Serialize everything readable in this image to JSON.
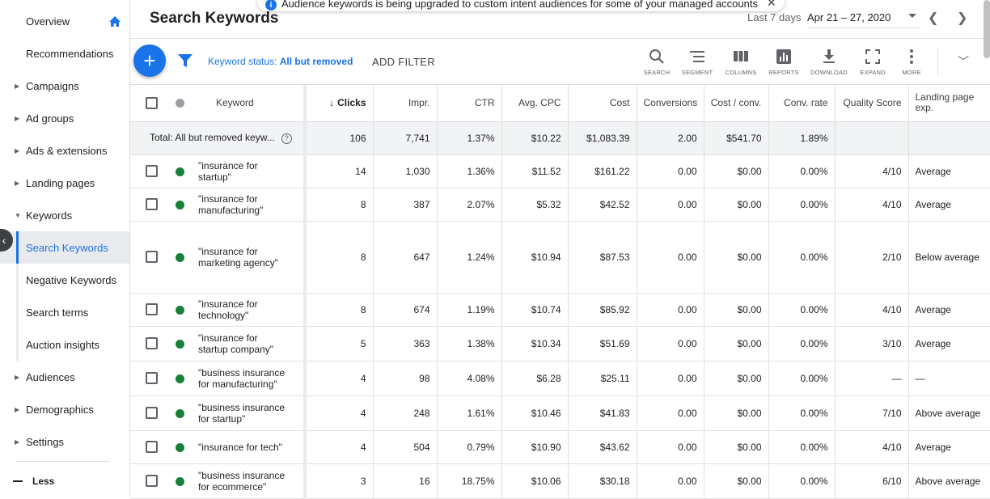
{
  "sidebar": {
    "items": [
      {
        "label": "Overview",
        "caret": false,
        "sub": false
      },
      {
        "label": "Recommendations",
        "caret": false,
        "sub": false
      },
      {
        "label": "Campaigns",
        "caret": true,
        "sub": false
      },
      {
        "label": "Ad groups",
        "caret": true,
        "sub": false
      },
      {
        "label": "Ads & extensions",
        "caret": true,
        "sub": false
      },
      {
        "label": "Landing pages",
        "caret": true,
        "sub": false
      },
      {
        "label": "Keywords",
        "caret": true,
        "sub": false,
        "expanded": true
      },
      {
        "label": "Search Keywords",
        "caret": false,
        "sub": true,
        "active": true
      },
      {
        "label": "Negative Keywords",
        "caret": false,
        "sub": true
      },
      {
        "label": "Search terms",
        "caret": false,
        "sub": true
      },
      {
        "label": "Auction insights",
        "caret": false,
        "sub": true
      },
      {
        "label": "Audiences",
        "caret": true,
        "sub": false
      },
      {
        "label": "Demographics",
        "caret": true,
        "sub": false
      },
      {
        "label": "Settings",
        "caret": true,
        "sub": false
      }
    ],
    "less_label": "Less"
  },
  "header": {
    "title": "Search Keywords",
    "banner_text": "Audience keywords is being upgraded to custom intent audiences for some of your managed accounts",
    "date_label": "Last 7 days",
    "date_range": "Apr 21 – 27, 2020"
  },
  "toolbar": {
    "filter_prefix": "Keyword status: ",
    "filter_value": "All but removed",
    "add_filter": "ADD FILTER",
    "tools": [
      {
        "label": "SEARCH",
        "icon": "search-icon"
      },
      {
        "label": "SEGMENT",
        "icon": "segment-icon"
      },
      {
        "label": "COLUMNS",
        "icon": "columns-icon"
      },
      {
        "label": "REPORTS",
        "icon": "reports-icon"
      },
      {
        "label": "DOWNLOAD",
        "icon": "download-icon"
      },
      {
        "label": "EXPAND",
        "icon": "expand-icon"
      },
      {
        "label": "MORE",
        "icon": "more-icon"
      }
    ]
  },
  "colors": {
    "accent": "#1a73e8",
    "status_enabled": "#188038"
  },
  "table": {
    "headers": {
      "keyword": "Keyword",
      "clicks": "Clicks",
      "impr": "Impr.",
      "ctr": "CTR",
      "avg_cpc": "Avg. CPC",
      "cost": "Cost",
      "conversions": "Conversions",
      "cost_conv": "Cost / conv.",
      "conv_rate": "Conv. rate",
      "quality_score": "Quality Score",
      "landing_page": "Landing page exp."
    },
    "total": {
      "label": "Total: All but removed keyw...",
      "clicks": "106",
      "impr": "7,741",
      "ctr": "1.37%",
      "avg_cpc": "$10.22",
      "cost": "$1,083.39",
      "conversions": "2.00",
      "cost_conv": "$541.70",
      "conv_rate": "1.89%",
      "quality_score": "",
      "landing_page": ""
    },
    "rows": [
      {
        "keyword": "\"insurance for startup\"",
        "clicks": "14",
        "impr": "1,030",
        "ctr": "1.36%",
        "avg_cpc": "$11.52",
        "cost": "$161.22",
        "conversions": "0.00",
        "cost_conv": "$0.00",
        "conv_rate": "0.00%",
        "quality_score": "4/10",
        "landing_page": "Average"
      },
      {
        "keyword": "\"insurance for manufacturing\"",
        "clicks": "8",
        "impr": "387",
        "ctr": "2.07%",
        "avg_cpc": "$5.32",
        "cost": "$42.52",
        "conversions": "0.00",
        "cost_conv": "$0.00",
        "conv_rate": "0.00%",
        "quality_score": "4/10",
        "landing_page": "Average"
      },
      {
        "keyword": "\"insurance for marketing agency\"",
        "clicks": "8",
        "impr": "647",
        "ctr": "1.24%",
        "avg_cpc": "$10.94",
        "cost": "$87.53",
        "conversions": "0.00",
        "cost_conv": "$0.00",
        "conv_rate": "0.00%",
        "quality_score": "2/10",
        "landing_page": "Below average"
      },
      {
        "keyword": "\"insurance for technology\"",
        "clicks": "8",
        "impr": "674",
        "ctr": "1.19%",
        "avg_cpc": "$10.74",
        "cost": "$85.92",
        "conversions": "0.00",
        "cost_conv": "$0.00",
        "conv_rate": "0.00%",
        "quality_score": "4/10",
        "landing_page": "Average"
      },
      {
        "keyword": "\"insurance for startup company\"",
        "clicks": "5",
        "impr": "363",
        "ctr": "1.38%",
        "avg_cpc": "$10.34",
        "cost": "$51.69",
        "conversions": "0.00",
        "cost_conv": "$0.00",
        "conv_rate": "0.00%",
        "quality_score": "3/10",
        "landing_page": "Average"
      },
      {
        "keyword": "\"business insurance for manufacturing\"",
        "clicks": "4",
        "impr": "98",
        "ctr": "4.08%",
        "avg_cpc": "$6.28",
        "cost": "$25.11",
        "conversions": "0.00",
        "cost_conv": "$0.00",
        "conv_rate": "0.00%",
        "quality_score": "—",
        "landing_page": "—"
      },
      {
        "keyword": "\"business insurance for startup\"",
        "clicks": "4",
        "impr": "248",
        "ctr": "1.61%",
        "avg_cpc": "$10.46",
        "cost": "$41.83",
        "conversions": "0.00",
        "cost_conv": "$0.00",
        "conv_rate": "0.00%",
        "quality_score": "7/10",
        "landing_page": "Above average"
      },
      {
        "keyword": "\"insurance for tech\"",
        "clicks": "4",
        "impr": "504",
        "ctr": "0.79%",
        "avg_cpc": "$10.90",
        "cost": "$43.62",
        "conversions": "0.00",
        "cost_conv": "$0.00",
        "conv_rate": "0.00%",
        "quality_score": "4/10",
        "landing_page": "Average"
      },
      {
        "keyword": "\"business insurance for ecommerce\"",
        "clicks": "3",
        "impr": "16",
        "ctr": "18.75%",
        "avg_cpc": "$10.06",
        "cost": "$30.18",
        "conversions": "0.00",
        "cost_conv": "$0.00",
        "conv_rate": "0.00%",
        "quality_score": "6/10",
        "landing_page": "Above average"
      }
    ]
  }
}
